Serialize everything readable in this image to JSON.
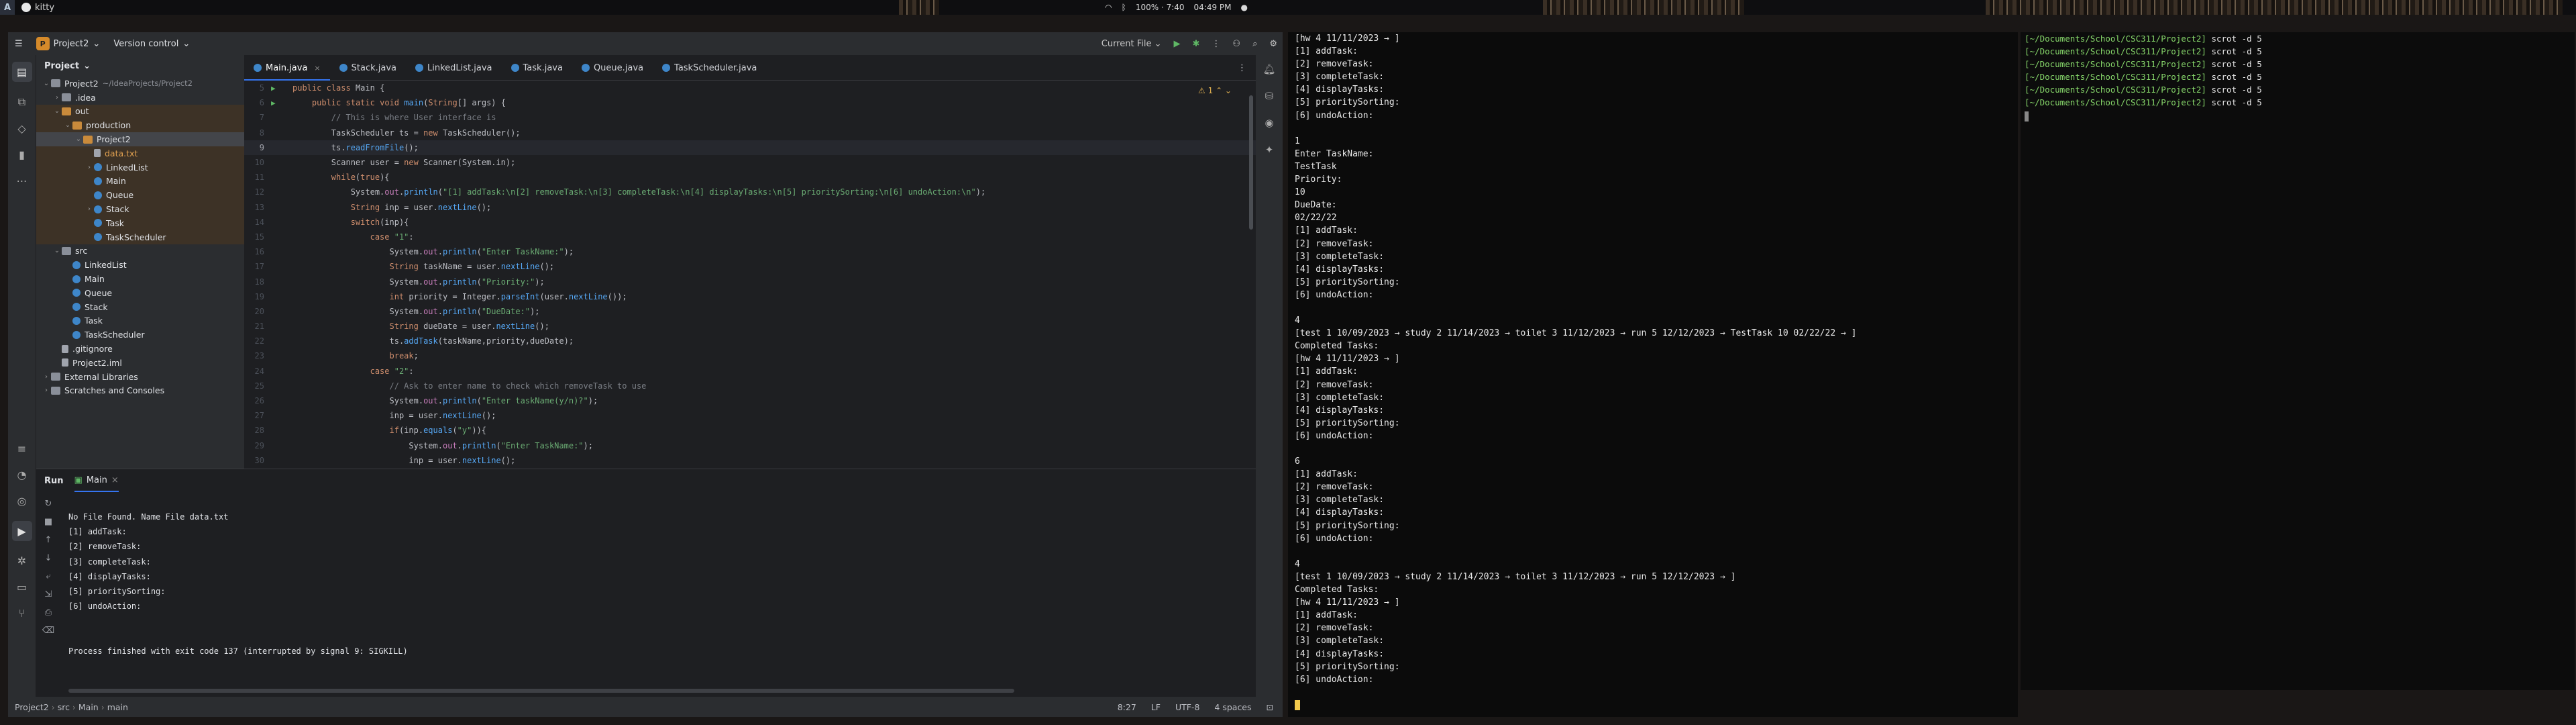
{
  "topbar": {
    "workspace": "A",
    "app_title": "kitty",
    "status_right": "100% · 7:40",
    "clock": "04:49 PM"
  },
  "ide": {
    "project_name": "Project2",
    "version_control": "Version control",
    "run_config": "Current File",
    "project_panel_title": "Project",
    "tree": [
      {
        "label": "Project2",
        "path": "~/IdeaProjects/Project2",
        "depth": 0,
        "kind": "folder",
        "open": true
      },
      {
        "label": ".idea",
        "depth": 1,
        "kind": "folder",
        "open": false
      },
      {
        "label": "out",
        "depth": 1,
        "kind": "folder-excluded",
        "open": true
      },
      {
        "label": "production",
        "depth": 2,
        "kind": "folder-excluded",
        "open": true
      },
      {
        "label": "Project2",
        "depth": 3,
        "kind": "folder-excluded",
        "open": true,
        "selected": true
      },
      {
        "label": "data.txt",
        "depth": 4,
        "kind": "file"
      },
      {
        "label": "LinkedList",
        "depth": 4,
        "kind": "class",
        "caret": true
      },
      {
        "label": "Main",
        "depth": 4,
        "kind": "class"
      },
      {
        "label": "Queue",
        "depth": 4,
        "kind": "class"
      },
      {
        "label": "Stack",
        "depth": 4,
        "kind": "class",
        "caret": true
      },
      {
        "label": "Task",
        "depth": 4,
        "kind": "class"
      },
      {
        "label": "TaskScheduler",
        "depth": 4,
        "kind": "class"
      },
      {
        "label": "src",
        "depth": 1,
        "kind": "folder",
        "open": true
      },
      {
        "label": "LinkedList",
        "depth": 2,
        "kind": "class"
      },
      {
        "label": "Main",
        "depth": 2,
        "kind": "class"
      },
      {
        "label": "Queue",
        "depth": 2,
        "kind": "class"
      },
      {
        "label": "Stack",
        "depth": 2,
        "kind": "class"
      },
      {
        "label": "Task",
        "depth": 2,
        "kind": "class"
      },
      {
        "label": "TaskScheduler",
        "depth": 2,
        "kind": "class"
      },
      {
        "label": ".gitignore",
        "depth": 1,
        "kind": "file"
      },
      {
        "label": "Project2.iml",
        "depth": 1,
        "kind": "file"
      },
      {
        "label": "External Libraries",
        "depth": 0,
        "kind": "folder",
        "open": false
      },
      {
        "label": "Scratches and Consoles",
        "depth": 0,
        "kind": "folder",
        "open": false
      }
    ],
    "tabs": [
      {
        "label": "Main.java",
        "active": true
      },
      {
        "label": "Stack.java"
      },
      {
        "label": "LinkedList.java"
      },
      {
        "label": "Task.java"
      },
      {
        "label": "Queue.java"
      },
      {
        "label": "TaskScheduler.java"
      }
    ],
    "warning_count": "1",
    "code_lines": [
      {
        "n": "5",
        "t": "public class Main {",
        "g": "▶"
      },
      {
        "n": "6",
        "t": "    public static void main(String[] args) {",
        "g": "▶"
      },
      {
        "n": "7",
        "t": "        // This is where User interface is"
      },
      {
        "n": "8",
        "t": "        TaskScheduler ts = new TaskScheduler();"
      },
      {
        "n": "9",
        "t": "        ts.readFromFile();",
        "cur": true
      },
      {
        "n": "10",
        "t": "        Scanner user = new Scanner(System.in);"
      },
      {
        "n": "11",
        "t": "        while(true){"
      },
      {
        "n": "12",
        "t": "            System.out.println(\"[1] addTask:\\n[2] removeTask:\\n[3] completeTask:\\n[4] displayTasks:\\n[5] prioritySorting:\\n[6] undoAction:\\n\");"
      },
      {
        "n": "13",
        "t": "            String inp = user.nextLine();"
      },
      {
        "n": "14",
        "t": "            switch(inp){"
      },
      {
        "n": "15",
        "t": "                case \"1\":"
      },
      {
        "n": "16",
        "t": "                    System.out.println(\"Enter TaskName:\");"
      },
      {
        "n": "17",
        "t": "                    String taskName = user.nextLine();"
      },
      {
        "n": "18",
        "t": "                    System.out.println(\"Priority:\");"
      },
      {
        "n": "19",
        "t": "                    int priority = Integer.parseInt(user.nextLine());"
      },
      {
        "n": "20",
        "t": "                    System.out.println(\"DueDate:\");"
      },
      {
        "n": "21",
        "t": "                    String dueDate = user.nextLine();"
      },
      {
        "n": "22",
        "t": "                    ts.addTask(taskName,priority,dueDate);"
      },
      {
        "n": "23",
        "t": "                    break;"
      },
      {
        "n": "24",
        "t": "                case \"2\":"
      },
      {
        "n": "25",
        "t": "                    // Ask to enter name to check which removeTask to use"
      },
      {
        "n": "26",
        "t": "                    System.out.println(\"Enter taskName(y/n)?\");"
      },
      {
        "n": "27",
        "t": "                    inp = user.nextLine();"
      },
      {
        "n": "28",
        "t": "                    if(inp.equals(\"y\")){"
      },
      {
        "n": "29",
        "t": "                        System.out.println(\"Enter TaskName:\");"
      },
      {
        "n": "30",
        "t": "                        inp = user.nextLine();"
      }
    ],
    "run": {
      "title": "Run",
      "tab": "Main",
      "output": [
        "No File Found. Name File data.txt",
        "[1] addTask:",
        "[2] removeTask:",
        "[3] completeTask:",
        "[4] displayTasks:",
        "[5] prioritySorting:",
        "[6] undoAction:",
        "",
        "",
        "Process finished with exit code 137 (interrupted by signal 9: SIGKILL)"
      ]
    },
    "statusbar": {
      "crumbs": [
        "Project2",
        "src",
        "Main",
        "main"
      ],
      "position": "8:27",
      "line_sep": "LF",
      "encoding": "UTF-8",
      "indent": "4 spaces"
    }
  },
  "term1": {
    "lines": [
      "[hw 4 11/11/2023 → ]",
      "[1] addTask:",
      "[2] removeTask:",
      "[3] completeTask:",
      "[4] displayTasks:",
      "[5] prioritySorting:",
      "[6] undoAction:",
      "",
      "1",
      "Enter TaskName:",
      "TestTask",
      "Priority:",
      "10",
      "DueDate:",
      "02/22/22",
      "[1] addTask:",
      "[2] removeTask:",
      "[3] completeTask:",
      "[4] displayTasks:",
      "[5] prioritySorting:",
      "[6] undoAction:",
      "",
      "4",
      "[test 1 10/09/2023 → study 2 11/14/2023 → toilet 3 11/12/2023 → run 5 12/12/2023 → TestTask 10 02/22/22 → ]",
      "Completed Tasks:",
      "[hw 4 11/11/2023 → ]",
      "[1] addTask:",
      "[2] removeTask:",
      "[3] completeTask:",
      "[4] displayTasks:",
      "[5] prioritySorting:",
      "[6] undoAction:",
      "",
      "6",
      "[1] addTask:",
      "[2] removeTask:",
      "[3] completeTask:",
      "[4] displayTasks:",
      "[5] prioritySorting:",
      "[6] undoAction:",
      "",
      "4",
      "[test 1 10/09/2023 → study 2 11/14/2023 → toilet 3 11/12/2023 → run 5 12/12/2023 → ]",
      "Completed Tasks:",
      "[hw 4 11/11/2023 → ]",
      "[1] addTask:",
      "[2] removeTask:",
      "[3] completeTask:",
      "[4] displayTasks:",
      "[5] prioritySorting:",
      "[6] undoAction:",
      ""
    ]
  },
  "term2": {
    "prompt_path": "[~/Documents/School/CSC311/Project2]",
    "command": "scrot -d 5",
    "repeat": 6
  },
  "colors": {
    "ide_bg": "#1e1f22",
    "ide_panel": "#2b2d30",
    "accent": "#3574f0",
    "terminal_cursor": "#f2c94c",
    "prompt_green": "#86d66a"
  }
}
